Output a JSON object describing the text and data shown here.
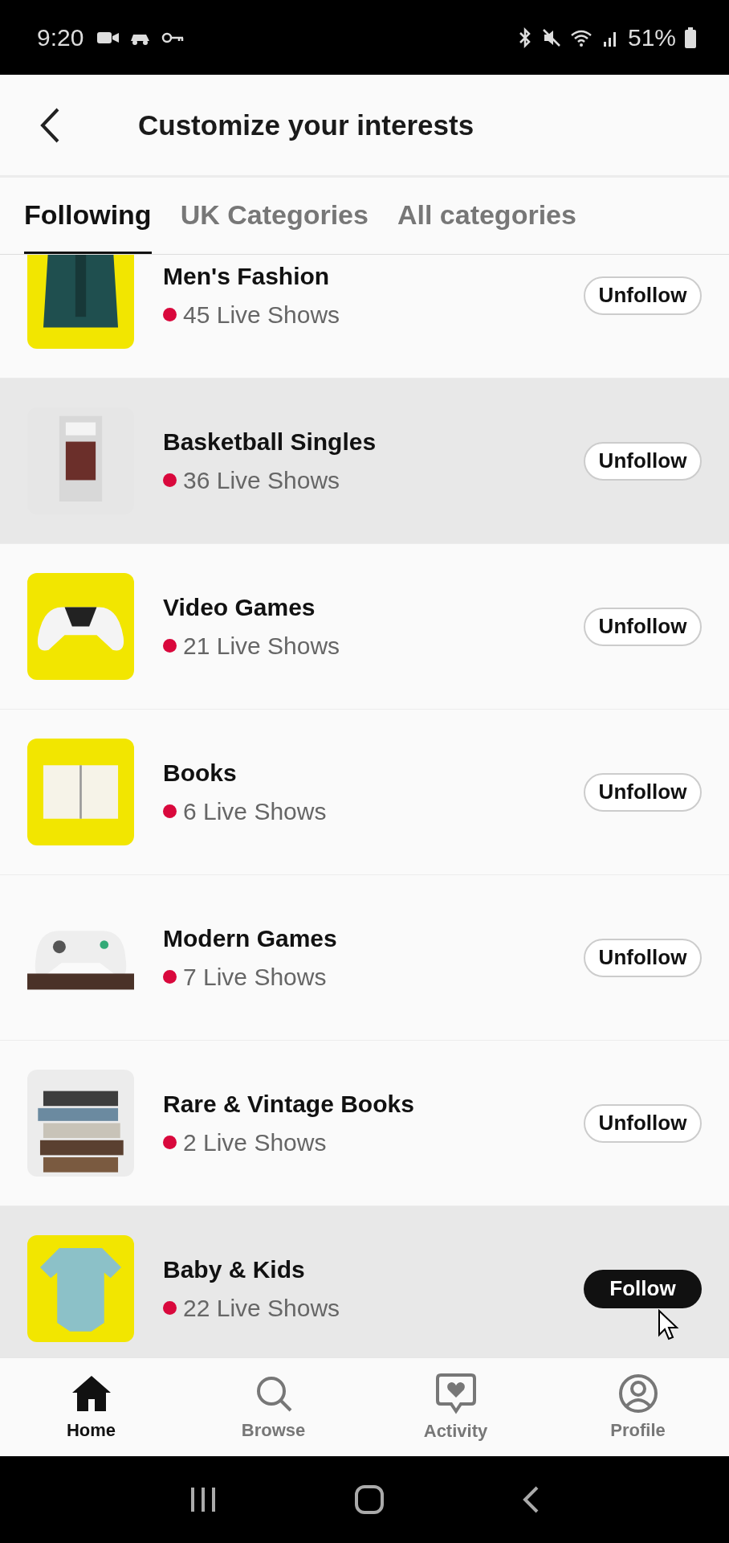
{
  "status_bar": {
    "time": "9:20",
    "battery": "51%"
  },
  "header": {
    "title": "Customize your interests"
  },
  "tabs": [
    {
      "label": "Following",
      "selected": true
    },
    {
      "label": "UK Categories",
      "selected": false
    },
    {
      "label": "All categories",
      "selected": false
    }
  ],
  "rows": [
    {
      "title": "Men's Fashion",
      "count": "45 Live Shows",
      "button": "Unfollow",
      "following": true,
      "highlighted": false
    },
    {
      "title": "Basketball Singles",
      "count": "36 Live Shows",
      "button": "Unfollow",
      "following": true,
      "highlighted": true
    },
    {
      "title": "Video Games",
      "count": "21 Live Shows",
      "button": "Unfollow",
      "following": true,
      "highlighted": false
    },
    {
      "title": "Books",
      "count": "6 Live Shows",
      "button": "Unfollow",
      "following": true,
      "highlighted": false
    },
    {
      "title": "Modern Games",
      "count": "7 Live Shows",
      "button": "Unfollow",
      "following": true,
      "highlighted": false
    },
    {
      "title": "Rare & Vintage Books",
      "count": "2 Live Shows",
      "button": "Unfollow",
      "following": true,
      "highlighted": false
    },
    {
      "title": "Baby & Kids",
      "count": "22 Live Shows",
      "button": "Follow",
      "following": false,
      "highlighted": true
    }
  ],
  "nav": [
    {
      "label": "Home",
      "selected": true
    },
    {
      "label": "Browse",
      "selected": false
    },
    {
      "label": "Activity",
      "selected": false
    },
    {
      "label": "Profile",
      "selected": false
    }
  ]
}
